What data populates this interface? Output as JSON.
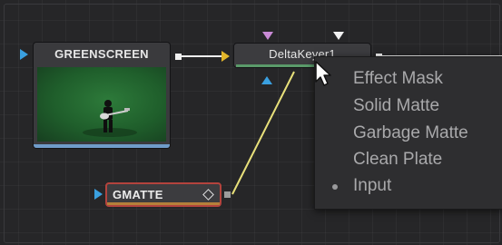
{
  "nodes": {
    "greenscreen": {
      "title": "GREENSCREEN"
    },
    "deltakeyer": {
      "title": "DeltaKeyer1"
    },
    "gmatte": {
      "title": "GMATTE"
    }
  },
  "context_menu": {
    "items": [
      {
        "label": "Effect Mask"
      },
      {
        "label": "Solid Matte"
      },
      {
        "label": "Garbage Matte"
      },
      {
        "label": "Clean Plate"
      },
      {
        "label": "Input",
        "selected": true
      }
    ]
  },
  "colors": {
    "background_input": "#e3b62a",
    "effect_mask_input": "#3aa0e0",
    "link_wire": "#e8e07a",
    "gmatte_selected_border": "#b3433d",
    "greenscreen_bar": "#6f9cc9",
    "deltakeyer_bar": "#5a9a6a",
    "gmatte_bar": "#b5803a"
  },
  "icons": [
    "input-arrow-icon",
    "output-port-icon",
    "diamond-icon",
    "mouse-cursor-icon",
    "bullet-icon"
  ]
}
